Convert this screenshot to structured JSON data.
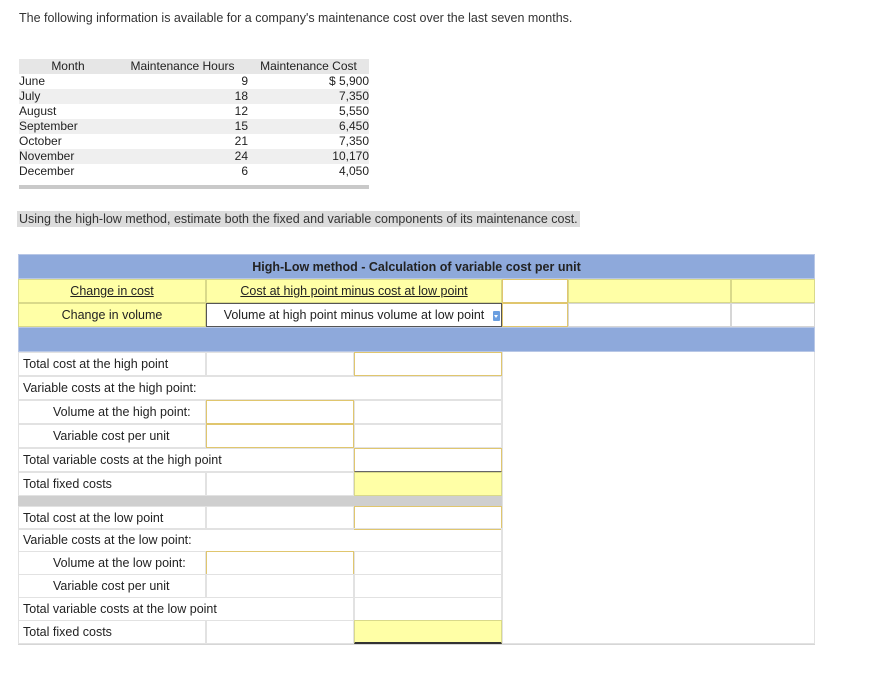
{
  "intro_text": "The following information is available for a company's maintenance cost over the last seven months.",
  "data_table": {
    "headers": [
      "Month",
      "Maintenance Hours",
      "Maintenance Cost"
    ],
    "rows": [
      {
        "month": "June",
        "hours": "9",
        "cost": "$ 5,900"
      },
      {
        "month": "July",
        "hours": "18",
        "cost": "7,350"
      },
      {
        "month": "August",
        "hours": "12",
        "cost": "5,550"
      },
      {
        "month": "September",
        "hours": "15",
        "cost": "6,450"
      },
      {
        "month": "October",
        "hours": "21",
        "cost": "7,350"
      },
      {
        "month": "November",
        "hours": "24",
        "cost": "10,170"
      },
      {
        "month": "December",
        "hours": "6",
        "cost": "4,050"
      }
    ]
  },
  "question_text": "Using the high-low method, estimate both the fixed and variable components of its maintenance cost.",
  "worksheet": {
    "title": "High-Low method - Calculation of variable cost per unit",
    "change_in_cost_label": "Change in cost",
    "change_in_cost_value": "Cost at high point minus cost at low point",
    "change_in_volume_label": "Change in volume",
    "change_in_volume_value": "Volume at high point minus volume at low point",
    "high": {
      "total_cost": "Total cost at the high point",
      "variable_costs": "Variable costs at the high point:",
      "volume": "Volume at the high point:",
      "var_cost_per_unit": "Variable cost per unit",
      "total_variable": "Total variable costs at the high point",
      "total_fixed": "Total fixed costs"
    },
    "low": {
      "total_cost": "Total cost at the low point",
      "variable_costs": "Variable costs at the low point:",
      "volume": "Volume at the low point:",
      "var_cost_per_unit": "Variable cost per unit",
      "total_variable": "Total variable costs at the low point",
      "total_fixed": "Total fixed costs"
    }
  }
}
